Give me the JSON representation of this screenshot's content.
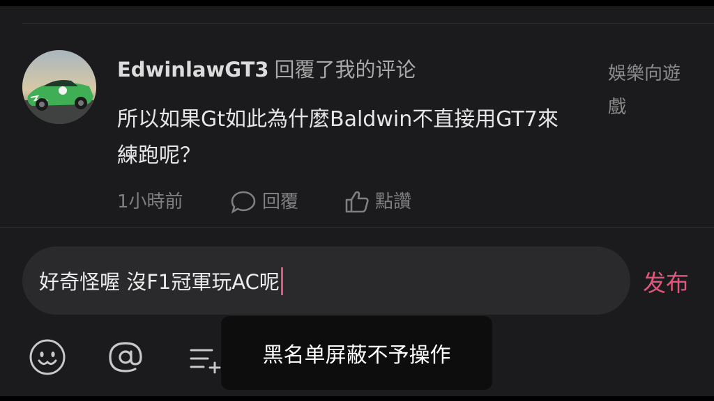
{
  "comment": {
    "username": "EdwinlawGT3",
    "action": "回覆了我的评论",
    "body": "所以如果Gt如此為什麼Baldwin不直接用GT7來練跑呢？",
    "source_tag": "娛樂向遊戲",
    "time": "1小時前",
    "reply_label": "回覆",
    "like_label": "點讚"
  },
  "composer": {
    "text": "好奇怪喔 沒F1冠軍玩AC呢",
    "publish_label": "发布"
  },
  "toolbar": {
    "icons": [
      "emoji-icon",
      "mention-icon",
      "add-list-icon"
    ]
  },
  "toast": {
    "message": "黑名单屏蔽不予操作"
  },
  "colors": {
    "background": "#1b1b1d",
    "accent": "#e0577c",
    "input_background": "#2a2a2c",
    "toast_background": "#0d0d0d"
  }
}
